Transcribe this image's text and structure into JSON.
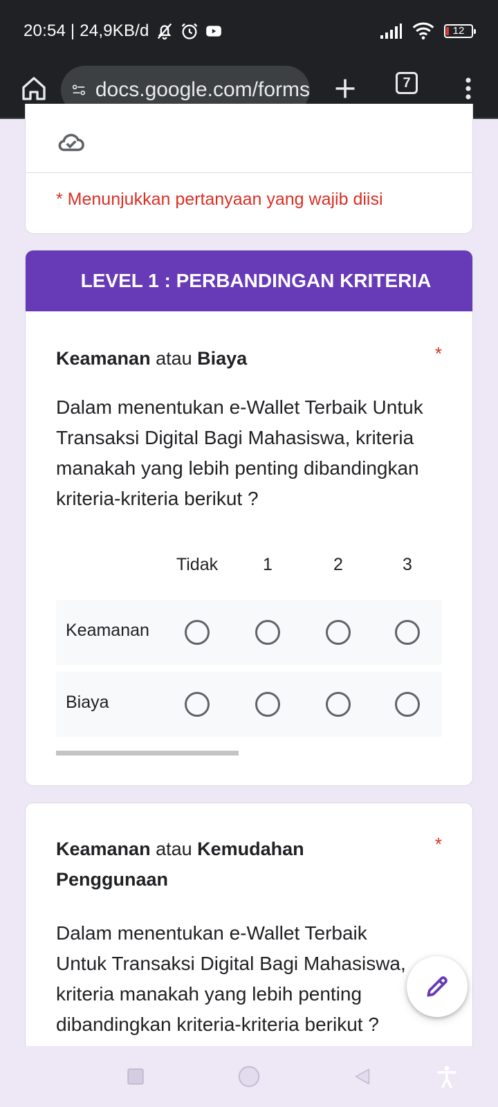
{
  "status_bar": {
    "time_and_speed": "20:54 | 24,9KB/d",
    "battery_level": "12",
    "icons": [
      "notifications-off-icon",
      "alarm-icon",
      "youtube-icon",
      "signal-icon",
      "wifi-icon",
      "battery-icon"
    ]
  },
  "browser": {
    "url": "docs.google.com/forms",
    "tab_count": "7",
    "icons": [
      "home-icon",
      "site-settings-icon",
      "plus-icon",
      "tab-switcher-icon",
      "more-vert-icon"
    ]
  },
  "form": {
    "required_note": "* Menunjukkan pertanyaan yang wajib diisi",
    "section_title": "LEVEL 1 : PERBANDINGAN KRITERIA",
    "questions": [
      {
        "title_a": "Keamanan",
        "title_sep": " atau ",
        "title_b": "Biaya",
        "required_mark": "*",
        "description": "Dalam menentukan e-Wallet Terbaik Untuk Transaksi Digital Bagi Mahasiswa, kriteria manakah yang lebih penting dibandingkan kriteria-kriteria berikut ?",
        "columns": [
          "Tidak",
          "1",
          "2",
          "3"
        ],
        "rows": [
          "Keamanan",
          "Biaya"
        ]
      },
      {
        "title_a": "Keamanan",
        "title_sep": " atau ",
        "title_b": "Kemudahan Penggunaan",
        "required_mark": "*",
        "description": "Dalam menentukan e-Wallet Terbaik Untuk Transaksi Digital Bagi Mahasiswa, kriteria manakah yang lebih penting dibandingkan kriteria-kriteria berikut ?"
      }
    ]
  },
  "colors": {
    "accent": "#673ab7",
    "required": "#d93025",
    "page_background": "#ede7f6",
    "system_bar": "#202124"
  }
}
